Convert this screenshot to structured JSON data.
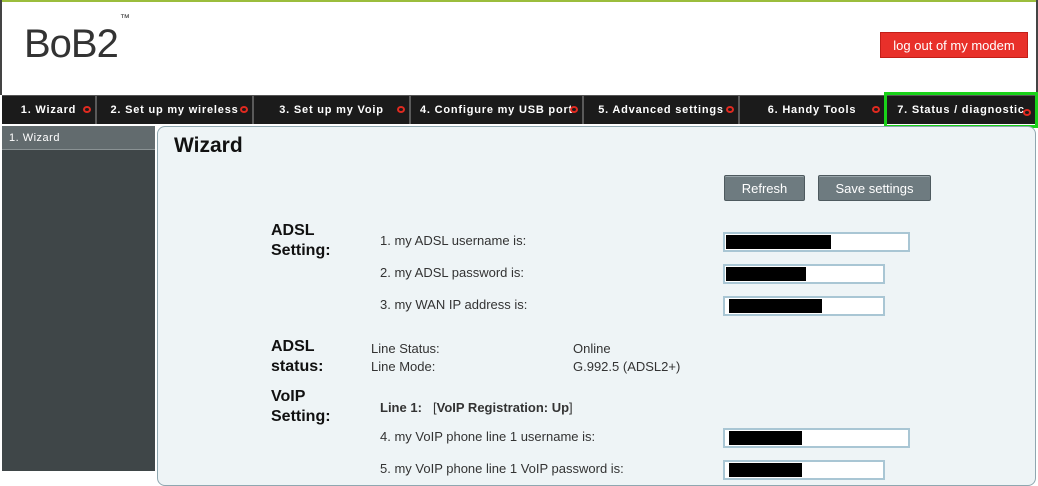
{
  "header": {
    "logo_text": "BoB2",
    "logo_mark": "™",
    "logout_label": "log out of my modem"
  },
  "nav": {
    "tabs": [
      {
        "label": "1. Wizard"
      },
      {
        "label": "2. Set up my wireless"
      },
      {
        "label": "3. Set up my Voip"
      },
      {
        "label": "4. Configure my USB port"
      },
      {
        "label": "5. Advanced settings"
      },
      {
        "label": "6. Handy Tools"
      },
      {
        "label": "7. Status / diagnostic"
      }
    ]
  },
  "sidebar": {
    "items": [
      {
        "label": "1. Wizard"
      }
    ]
  },
  "main": {
    "title": "Wizard",
    "refresh_label": "Refresh",
    "save_label": "Save settings",
    "adsl_setting": {
      "heading_line1": "ADSL",
      "heading_line2": "Setting:",
      "username_label": "1. my ADSL username is:",
      "password_label": "2. my ADSL password is:",
      "wan_label": "3. my WAN IP address is:"
    },
    "adsl_status": {
      "heading_line1": "ADSL",
      "heading_line2": "status:",
      "line_status_label": "Line Status:",
      "line_status_value": "Online",
      "line_mode_label": "Line Mode:",
      "line_mode_value": "G.992.5 (ADSL2+)"
    },
    "voip_setting": {
      "heading_line1": "VoIP",
      "heading_line2": "Setting:",
      "line1_label": "Line 1:",
      "line1_status_open": "[",
      "line1_status": "VoIP Registration: Up",
      "line1_status_close": "]",
      "username_label": "4. my VoIP phone line 1 username is:",
      "password_label": "5. my VoIP phone line 1 VoIP password is:"
    }
  },
  "colors": {
    "accent_green": "#19d219",
    "logout_red": "#e8302a",
    "nav_bg": "#1b1b1b",
    "panel_bg": "#eef4f6"
  }
}
